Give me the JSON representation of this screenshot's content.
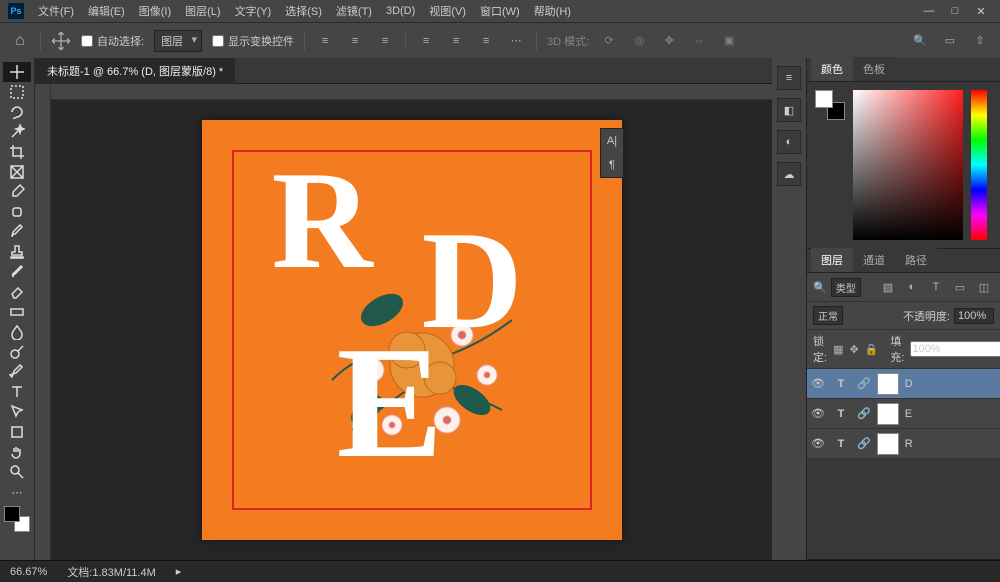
{
  "menu": {
    "items": [
      "文件(F)",
      "编辑(E)",
      "图像(I)",
      "图层(L)",
      "文字(Y)",
      "选择(S)",
      "滤镜(T)",
      "3D(D)",
      "视图(V)",
      "窗口(W)",
      "帮助(H)"
    ]
  },
  "optbar": {
    "autoSelect": "自动选择:",
    "layerDD": "图层",
    "showTransform": "显示变换控件",
    "mode3d": "3D 模式:"
  },
  "tab": {
    "title": "未标题-1 @ 66.7% (D, 图层蒙版/8) *"
  },
  "color": {
    "tabs": [
      "颜色",
      "色板"
    ]
  },
  "layers": {
    "tabs": [
      "图层",
      "通道",
      "路径"
    ],
    "filterLabel": "类型",
    "blend": "正常",
    "opacityLabel": "不透明度:",
    "opacity": "100%",
    "lockLabel": "锁定:",
    "fillLabel": "填充:",
    "fill": "100%",
    "rows": [
      {
        "name": "D",
        "sel": true
      },
      {
        "name": "E",
        "sel": false
      },
      {
        "name": "R",
        "sel": false
      }
    ]
  },
  "status": {
    "zoom": "66.67%",
    "doc": "文档:1.83M/11.4M"
  }
}
